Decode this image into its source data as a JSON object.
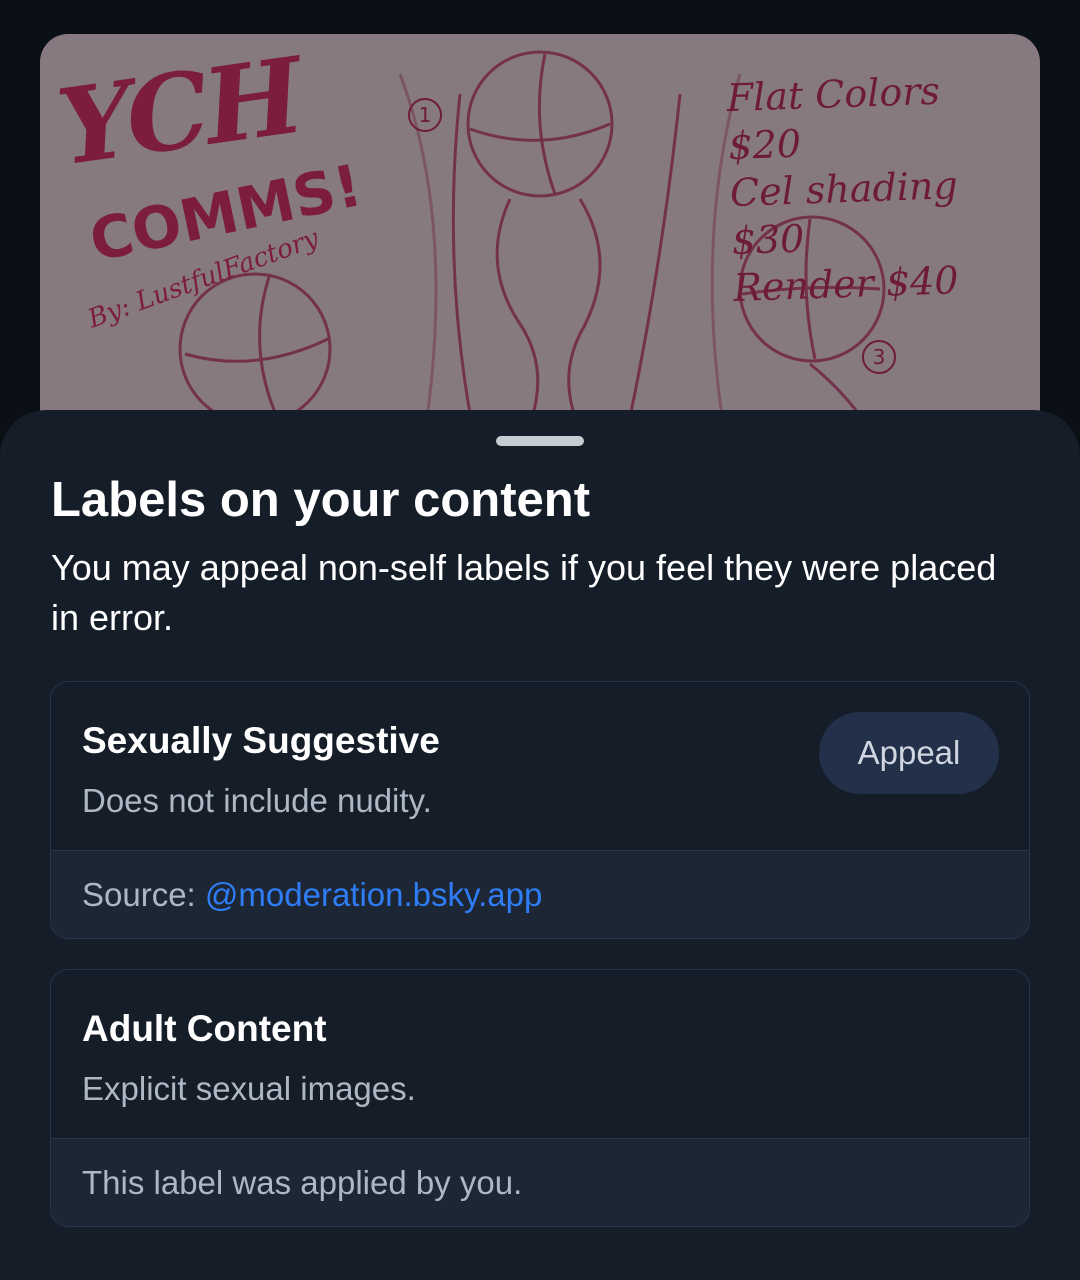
{
  "post_image": {
    "ych_title": "YCH",
    "ych_comms": "COMMS!",
    "artist": "By: LustfulFactory",
    "prices": [
      "Flat Colors $20",
      "Cel shading $30",
      "Render $40"
    ],
    "markers": [
      "1",
      "3"
    ]
  },
  "sheet": {
    "title": "Labels on your content",
    "subtitle": "You may appeal non-self labels if you feel they were placed in error.",
    "labels": [
      {
        "name": "Sexually Suggestive",
        "description": "Does not include nudity.",
        "appeal_label": "Appeal",
        "source_prefix": "Source: ",
        "source_handle": "@moderation.bsky.app"
      },
      {
        "name": "Adult Content",
        "description": "Explicit sexual images.",
        "footer": "This label was applied by you."
      }
    ]
  },
  "colors": {
    "sheet_bg": "#151d28",
    "card_footer_bg": "#1c2635",
    "link": "#2f7df6",
    "appeal_bg": "#23304a"
  }
}
